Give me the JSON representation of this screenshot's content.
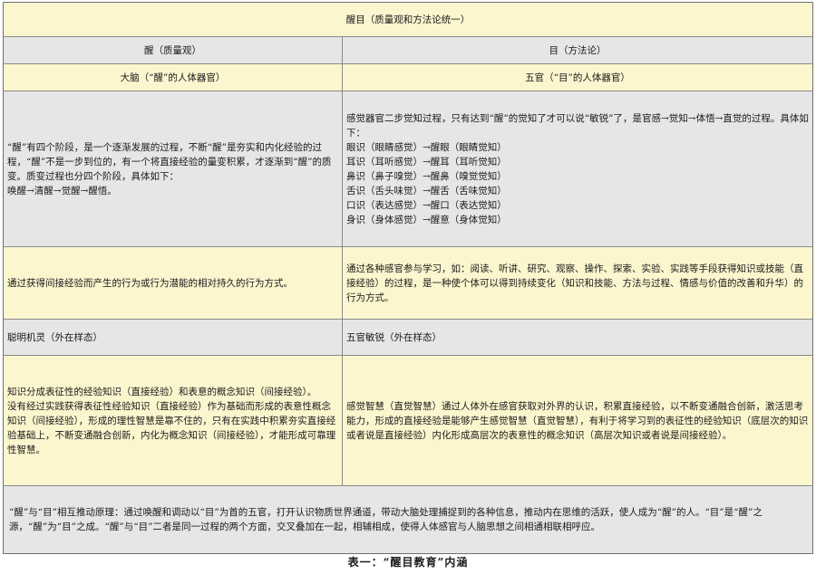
{
  "header": {
    "title": "醒目（质量观和方法论统一）"
  },
  "columns": {
    "left": "醒（质量观）",
    "right": "目（方法论）"
  },
  "organs": {
    "left": "大脑（“醒”的人体器官）",
    "right": "五官（“目”的人体器官）"
  },
  "stages": {
    "left": "“醒”有四个阶段，是一个逐渐发展的过程，不断“醒”是夯实和内化经验的过程，“醒”不是一步到位的，有一个将直接经验的量变积累，才逐渐到“醒”的质变。质变过程也分四个阶段，具体如下：\n唤醒→清醒→觉醒→醒悟。",
    "right": "感觉器官二步觉知过程，只有达到“醒”的觉知了才可以说“敏锐”了，是官感→觉知→体悟→直觉的过程。具体如下：\n眼识（眼睛感觉）→醒眼（眼睛觉知）\n耳识（耳听感觉）→醒耳（耳听觉知）\n鼻识（鼻子嗅觉）→醒鼻（嗅觉觉知）\n舌识（舌头味觉）→醒舌（舌味觉知）\n口识（表达感觉）→醒口（表达觉知）\n身识（身体感觉）→醒意（身体觉知）"
  },
  "learning": {
    "left": "通过获得间接经验而产生的行为或行为潜能的相对持久的行为方式。",
    "right": "通过各种感官参与学习，如：阅读、听讲、研究、观察、操作、探索、实验、实践等手段获得知识或技能（直接经验）的过程，是一种使个体可以得到持续变化（知识和技能、方法与过程、情感与价值的改善和升华）的行为方式。"
  },
  "appearance": {
    "left": "聪明机灵（外在样态）",
    "right": "五官敏锐（外在样态）"
  },
  "wisdom": {
    "left": "知识分成表征性的经验知识（直接经验）和表意的概念知识（间接经验）。\n没有经过实践获得表征性经验知识（直接经验）作为基础而形成的表意性概念知识（间接经验），形成的理性智慧是靠不住的，只有在实践中积累夯实直接经验基础上，不断变通融合创新，内化为概念知识（间接经验），才能形成可靠理性智慧。",
    "right": "感觉智慧（直觉智慧）通过人体外在感官获取对外界的认识，积累直接经验，以不断变通融合创新，激活思考能力，形成的直接经验是能够产生感觉智慧（直觉智慧），有利于将学习到的表征性的经验知识（底层次的知识或者说是直接经验）内化形成高层次的表意性的概念知识（高层次知识或者说是间接经验）。"
  },
  "summary": "“醒”与“目”相互推动原理：通过唤醒和调动以“目”为首的五官，打开认识物质世界通道，带动大脑处理捕捉到的各种信息，推动内在思维的活跃，使人成为“醒”的人。“目”是“醒”之源，“醒”为“目”之成。“醒”与“目”二者是同一过程的两个方面，交叉叠加在一起，相辅相成，使得人体感官与人脑思想之间相通相联相呼应。",
  "caption": "表一：“醒目教育”内涵"
}
